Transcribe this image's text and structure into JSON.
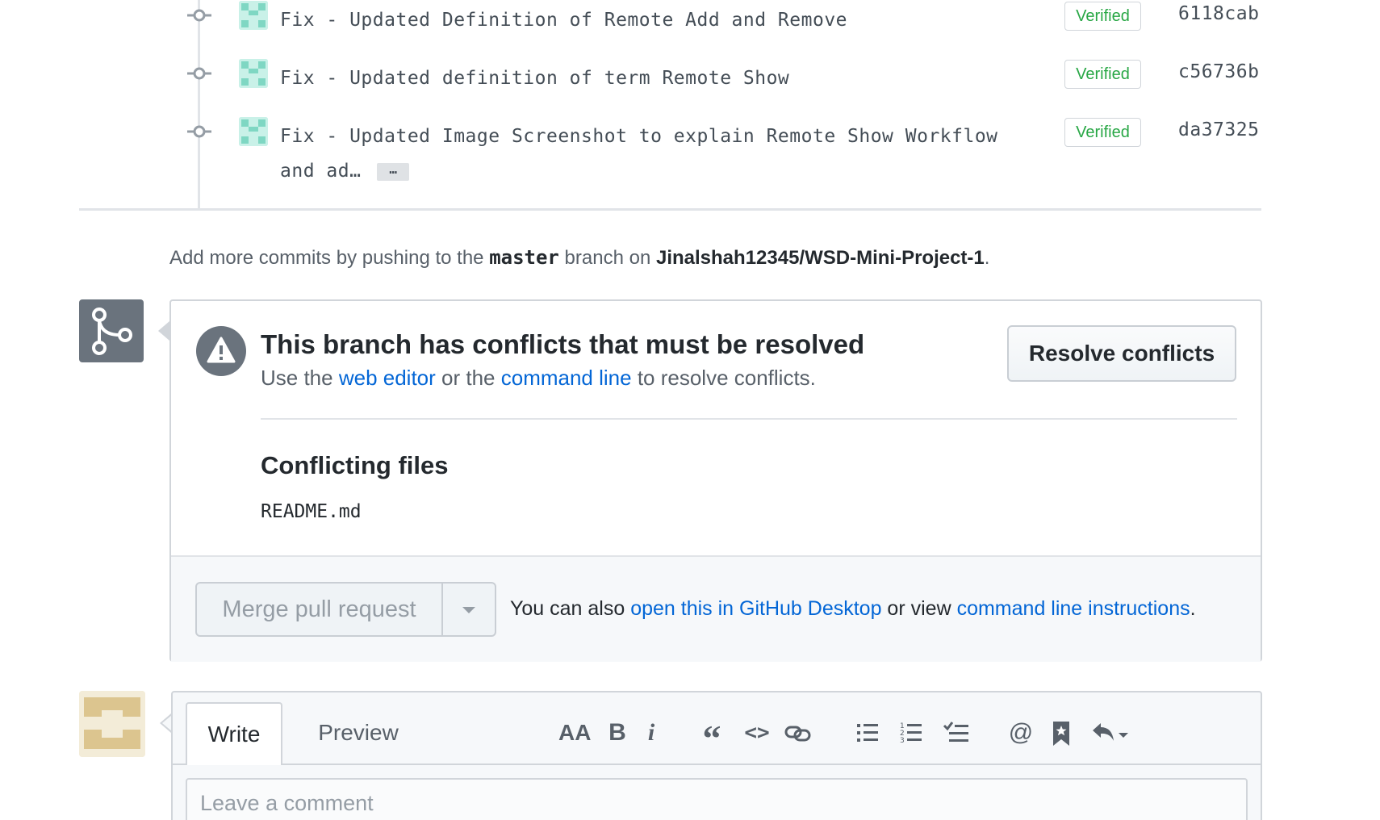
{
  "commits": [
    {
      "message": "Fix - Updated Definition of Remote Add and Remove",
      "badge": "Verified",
      "sha": "6118cab"
    },
    {
      "message": "Fix - Updated definition of term Remote Show",
      "badge": "Verified",
      "sha": "c56736b"
    },
    {
      "message": "Fix - Updated Image Screenshot to explain Remote Show Workflow",
      "message_cont": "and ad…",
      "ellipsis": "…",
      "badge": "Verified",
      "sha": "da37325"
    }
  ],
  "push_note": {
    "prefix": "Add more commits by pushing to the ",
    "branch": "master",
    "middle": " branch on ",
    "repo": "Jinalshah12345/WSD-Mini-Project-1",
    "suffix": "."
  },
  "merge": {
    "title": "This branch has conflicts that must be resolved",
    "sub_prefix": "Use the ",
    "web_editor_link": "web editor",
    "sub_middle": " or the ",
    "command_line_link": "command line",
    "sub_suffix": " to resolve conflicts.",
    "resolve_button": "Resolve conflicts",
    "files_title": "Conflicting files",
    "files": [
      "README.md"
    ],
    "merge_button": "Merge pull request",
    "footer_prefix": "You can also ",
    "desktop_link": "open this in GitHub Desktop",
    "footer_middle": " or view ",
    "instructions_link": "command line instructions",
    "footer_suffix": "."
  },
  "comment": {
    "tab_write": "Write",
    "tab_preview": "Preview",
    "placeholder": "Leave a comment",
    "toolbar": {
      "heading": "AA",
      "bold": "B",
      "italic": "i",
      "quote": "“",
      "code": "<>",
      "mention": "@"
    }
  },
  "colors": {
    "link": "#0366d6",
    "verified": "#28a745",
    "icon_gray": "#6a737d"
  }
}
